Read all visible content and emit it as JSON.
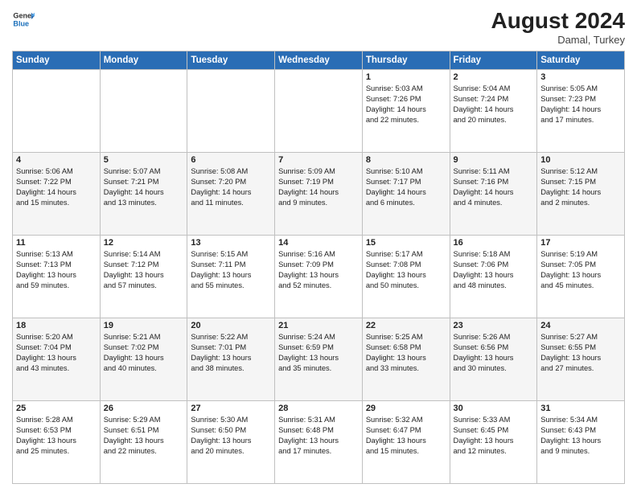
{
  "header": {
    "logo_line1": "General",
    "logo_line2": "Blue",
    "month_year": "August 2024",
    "location": "Damal, Turkey"
  },
  "weekdays": [
    "Sunday",
    "Monday",
    "Tuesday",
    "Wednesday",
    "Thursday",
    "Friday",
    "Saturday"
  ],
  "weeks": [
    [
      {
        "day": "",
        "text": ""
      },
      {
        "day": "",
        "text": ""
      },
      {
        "day": "",
        "text": ""
      },
      {
        "day": "",
        "text": ""
      },
      {
        "day": "1",
        "text": "Sunrise: 5:03 AM\nSunset: 7:26 PM\nDaylight: 14 hours\nand 22 minutes."
      },
      {
        "day": "2",
        "text": "Sunrise: 5:04 AM\nSunset: 7:24 PM\nDaylight: 14 hours\nand 20 minutes."
      },
      {
        "day": "3",
        "text": "Sunrise: 5:05 AM\nSunset: 7:23 PM\nDaylight: 14 hours\nand 17 minutes."
      }
    ],
    [
      {
        "day": "4",
        "text": "Sunrise: 5:06 AM\nSunset: 7:22 PM\nDaylight: 14 hours\nand 15 minutes."
      },
      {
        "day": "5",
        "text": "Sunrise: 5:07 AM\nSunset: 7:21 PM\nDaylight: 14 hours\nand 13 minutes."
      },
      {
        "day": "6",
        "text": "Sunrise: 5:08 AM\nSunset: 7:20 PM\nDaylight: 14 hours\nand 11 minutes."
      },
      {
        "day": "7",
        "text": "Sunrise: 5:09 AM\nSunset: 7:19 PM\nDaylight: 14 hours\nand 9 minutes."
      },
      {
        "day": "8",
        "text": "Sunrise: 5:10 AM\nSunset: 7:17 PM\nDaylight: 14 hours\nand 6 minutes."
      },
      {
        "day": "9",
        "text": "Sunrise: 5:11 AM\nSunset: 7:16 PM\nDaylight: 14 hours\nand 4 minutes."
      },
      {
        "day": "10",
        "text": "Sunrise: 5:12 AM\nSunset: 7:15 PM\nDaylight: 14 hours\nand 2 minutes."
      }
    ],
    [
      {
        "day": "11",
        "text": "Sunrise: 5:13 AM\nSunset: 7:13 PM\nDaylight: 13 hours\nand 59 minutes."
      },
      {
        "day": "12",
        "text": "Sunrise: 5:14 AM\nSunset: 7:12 PM\nDaylight: 13 hours\nand 57 minutes."
      },
      {
        "day": "13",
        "text": "Sunrise: 5:15 AM\nSunset: 7:11 PM\nDaylight: 13 hours\nand 55 minutes."
      },
      {
        "day": "14",
        "text": "Sunrise: 5:16 AM\nSunset: 7:09 PM\nDaylight: 13 hours\nand 52 minutes."
      },
      {
        "day": "15",
        "text": "Sunrise: 5:17 AM\nSunset: 7:08 PM\nDaylight: 13 hours\nand 50 minutes."
      },
      {
        "day": "16",
        "text": "Sunrise: 5:18 AM\nSunset: 7:06 PM\nDaylight: 13 hours\nand 48 minutes."
      },
      {
        "day": "17",
        "text": "Sunrise: 5:19 AM\nSunset: 7:05 PM\nDaylight: 13 hours\nand 45 minutes."
      }
    ],
    [
      {
        "day": "18",
        "text": "Sunrise: 5:20 AM\nSunset: 7:04 PM\nDaylight: 13 hours\nand 43 minutes."
      },
      {
        "day": "19",
        "text": "Sunrise: 5:21 AM\nSunset: 7:02 PM\nDaylight: 13 hours\nand 40 minutes."
      },
      {
        "day": "20",
        "text": "Sunrise: 5:22 AM\nSunset: 7:01 PM\nDaylight: 13 hours\nand 38 minutes."
      },
      {
        "day": "21",
        "text": "Sunrise: 5:24 AM\nSunset: 6:59 PM\nDaylight: 13 hours\nand 35 minutes."
      },
      {
        "day": "22",
        "text": "Sunrise: 5:25 AM\nSunset: 6:58 PM\nDaylight: 13 hours\nand 33 minutes."
      },
      {
        "day": "23",
        "text": "Sunrise: 5:26 AM\nSunset: 6:56 PM\nDaylight: 13 hours\nand 30 minutes."
      },
      {
        "day": "24",
        "text": "Sunrise: 5:27 AM\nSunset: 6:55 PM\nDaylight: 13 hours\nand 27 minutes."
      }
    ],
    [
      {
        "day": "25",
        "text": "Sunrise: 5:28 AM\nSunset: 6:53 PM\nDaylight: 13 hours\nand 25 minutes."
      },
      {
        "day": "26",
        "text": "Sunrise: 5:29 AM\nSunset: 6:51 PM\nDaylight: 13 hours\nand 22 minutes."
      },
      {
        "day": "27",
        "text": "Sunrise: 5:30 AM\nSunset: 6:50 PM\nDaylight: 13 hours\nand 20 minutes."
      },
      {
        "day": "28",
        "text": "Sunrise: 5:31 AM\nSunset: 6:48 PM\nDaylight: 13 hours\nand 17 minutes."
      },
      {
        "day": "29",
        "text": "Sunrise: 5:32 AM\nSunset: 6:47 PM\nDaylight: 13 hours\nand 15 minutes."
      },
      {
        "day": "30",
        "text": "Sunrise: 5:33 AM\nSunset: 6:45 PM\nDaylight: 13 hours\nand 12 minutes."
      },
      {
        "day": "31",
        "text": "Sunrise: 5:34 AM\nSunset: 6:43 PM\nDaylight: 13 hours\nand 9 minutes."
      }
    ]
  ]
}
